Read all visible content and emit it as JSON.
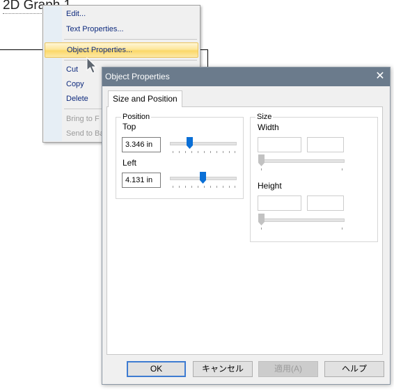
{
  "canvas": {
    "graph_title": "2D Graph 1"
  },
  "context_menu": {
    "items": [
      {
        "label": "Edit...",
        "enabled": true
      },
      {
        "label": "Text Properties...",
        "enabled": true
      },
      {
        "label": "Object Properties...",
        "enabled": true,
        "highlighted": true
      },
      {
        "label": "Cut",
        "enabled": true
      },
      {
        "label": "Copy",
        "enabled": true
      },
      {
        "label": "Delete",
        "enabled": true
      },
      {
        "label": "Bring to F",
        "enabled": false
      },
      {
        "label": "Send to Ba",
        "enabled": false
      }
    ]
  },
  "dialog": {
    "title": "Object Properties",
    "close_glyph": "✕",
    "tab": "Size and Position",
    "position": {
      "title": "Position",
      "top_label": "Top",
      "top_value": "3.346 in",
      "top_slider_fraction": 0.3,
      "left_label": "Left",
      "left_value": "4.131 in",
      "left_slider_fraction": 0.5
    },
    "size": {
      "title": "Size",
      "width_label": "Width",
      "width_value": "",
      "width_value2": "",
      "height_label": "Height",
      "height_value": "",
      "height_value2": ""
    },
    "buttons": {
      "ok": "OK",
      "cancel": "キャンセル",
      "apply": "適用(A)",
      "help": "ヘルプ"
    }
  },
  "colors": {
    "titlebar": "#6b7b8c",
    "accent": "#0a6fd6",
    "menu_highlight": "#fbd768",
    "menu_text": "#0f2b7e"
  }
}
